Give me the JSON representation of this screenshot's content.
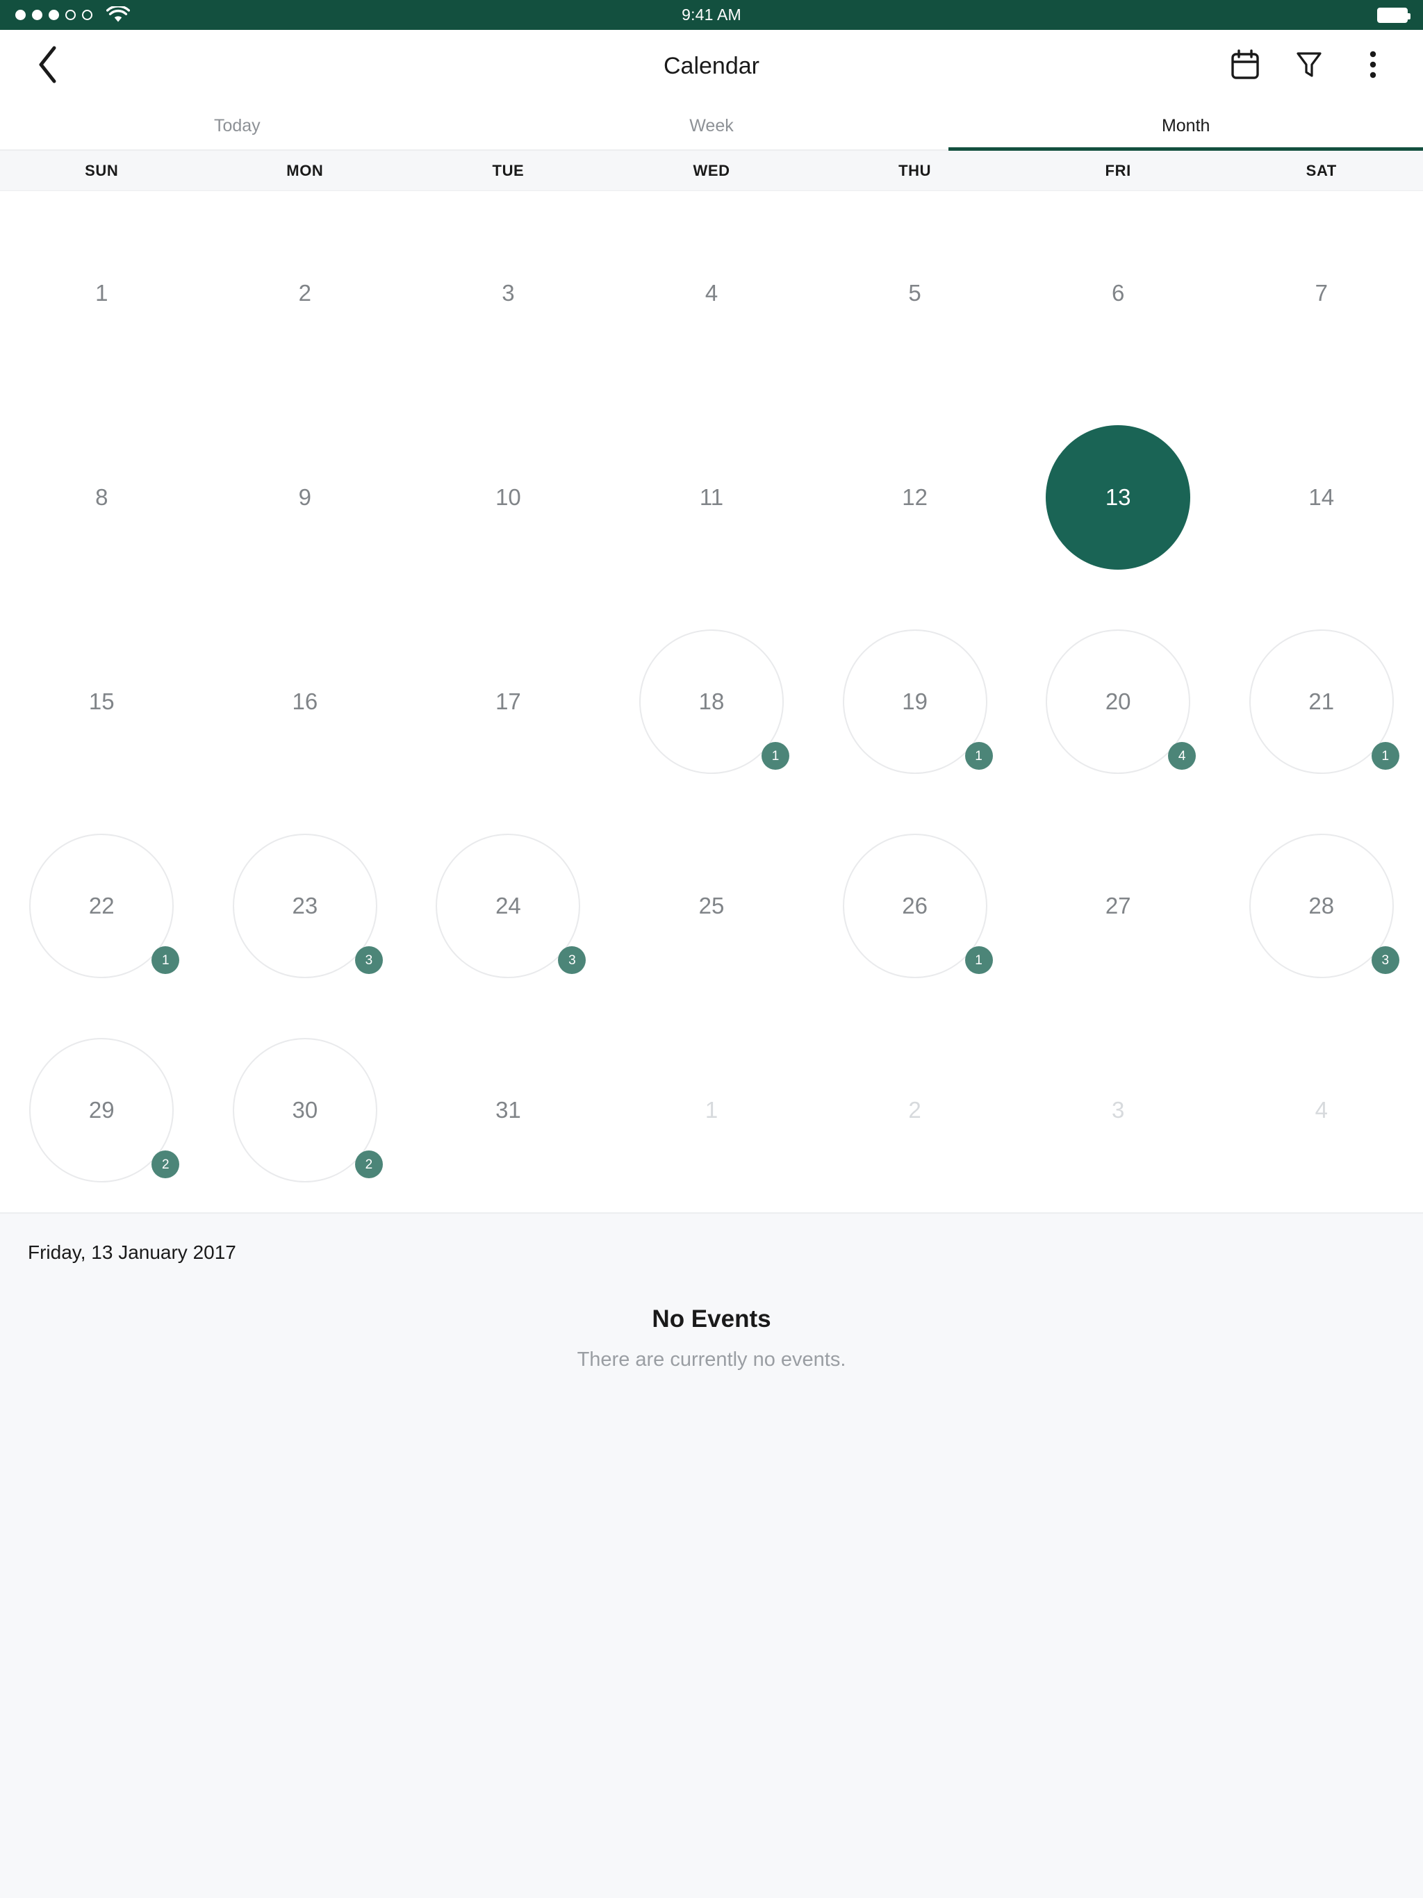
{
  "status_bar": {
    "time": "9:41 AM",
    "signal_dots_filled": 3,
    "signal_dots_total": 5,
    "wifi_icon": "wifi-icon",
    "battery_icon": "battery-full-icon",
    "background_color": "#13503F"
  },
  "nav": {
    "back_icon": "chevron-left-icon",
    "title": "Calendar",
    "actions": [
      {
        "icon": "calendar-icon",
        "name": "calendar-view-button"
      },
      {
        "icon": "filter-funnel-icon",
        "name": "filter-button"
      },
      {
        "icon": "overflow-menu-icon",
        "name": "overflow-menu-button"
      }
    ]
  },
  "tabs": {
    "items": [
      {
        "label": "Today",
        "active": false
      },
      {
        "label": "Week",
        "active": false
      },
      {
        "label": "Month",
        "active": true
      }
    ],
    "active_index": 2,
    "accent_color": "#13503F"
  },
  "weekdays": [
    "SUN",
    "MON",
    "TUE",
    "WED",
    "THU",
    "FRI",
    "SAT"
  ],
  "calendar": {
    "month_label": "January 2017",
    "selected_day": 13,
    "selected_color": "#1A6455",
    "badge_color": "#4C8578",
    "circle_outline_color": "#e9eaec",
    "weeks": [
      [
        {
          "day": "1",
          "in_month": true,
          "circle": false,
          "badge": null,
          "selected": false
        },
        {
          "day": "2",
          "in_month": true,
          "circle": false,
          "badge": null,
          "selected": false
        },
        {
          "day": "3",
          "in_month": true,
          "circle": false,
          "badge": null,
          "selected": false
        },
        {
          "day": "4",
          "in_month": true,
          "circle": false,
          "badge": null,
          "selected": false
        },
        {
          "day": "5",
          "in_month": true,
          "circle": false,
          "badge": null,
          "selected": false
        },
        {
          "day": "6",
          "in_month": true,
          "circle": false,
          "badge": null,
          "selected": false
        },
        {
          "day": "7",
          "in_month": true,
          "circle": false,
          "badge": null,
          "selected": false
        }
      ],
      [
        {
          "day": "8",
          "in_month": true,
          "circle": false,
          "badge": null,
          "selected": false
        },
        {
          "day": "9",
          "in_month": true,
          "circle": false,
          "badge": null,
          "selected": false
        },
        {
          "day": "10",
          "in_month": true,
          "circle": false,
          "badge": null,
          "selected": false
        },
        {
          "day": "11",
          "in_month": true,
          "circle": false,
          "badge": null,
          "selected": false
        },
        {
          "day": "12",
          "in_month": true,
          "circle": false,
          "badge": null,
          "selected": false
        },
        {
          "day": "13",
          "in_month": true,
          "circle": true,
          "badge": null,
          "selected": true
        },
        {
          "day": "14",
          "in_month": true,
          "circle": false,
          "badge": null,
          "selected": false
        }
      ],
      [
        {
          "day": "15",
          "in_month": true,
          "circle": false,
          "badge": null,
          "selected": false
        },
        {
          "day": "16",
          "in_month": true,
          "circle": false,
          "badge": null,
          "selected": false
        },
        {
          "day": "17",
          "in_month": true,
          "circle": false,
          "badge": null,
          "selected": false
        },
        {
          "day": "18",
          "in_month": true,
          "circle": true,
          "badge": "1",
          "selected": false
        },
        {
          "day": "19",
          "in_month": true,
          "circle": true,
          "badge": "1",
          "selected": false
        },
        {
          "day": "20",
          "in_month": true,
          "circle": true,
          "badge": "4",
          "selected": false
        },
        {
          "day": "21",
          "in_month": true,
          "circle": true,
          "badge": "1",
          "selected": false
        }
      ],
      [
        {
          "day": "22",
          "in_month": true,
          "circle": true,
          "badge": "1",
          "selected": false
        },
        {
          "day": "23",
          "in_month": true,
          "circle": true,
          "badge": "3",
          "selected": false
        },
        {
          "day": "24",
          "in_month": true,
          "circle": true,
          "badge": "3",
          "selected": false
        },
        {
          "day": "25",
          "in_month": true,
          "circle": false,
          "badge": null,
          "selected": false
        },
        {
          "day": "26",
          "in_month": true,
          "circle": true,
          "badge": "1",
          "selected": false
        },
        {
          "day": "27",
          "in_month": true,
          "circle": false,
          "badge": null,
          "selected": false
        },
        {
          "day": "28",
          "in_month": true,
          "circle": true,
          "badge": "3",
          "selected": false
        }
      ],
      [
        {
          "day": "29",
          "in_month": true,
          "circle": true,
          "badge": "2",
          "selected": false
        },
        {
          "day": "30",
          "in_month": true,
          "circle": true,
          "badge": "2",
          "selected": false
        },
        {
          "day": "31",
          "in_month": true,
          "circle": false,
          "badge": null,
          "selected": false
        },
        {
          "day": "1",
          "in_month": false,
          "circle": false,
          "badge": null,
          "selected": false
        },
        {
          "day": "2",
          "in_month": false,
          "circle": false,
          "badge": null,
          "selected": false
        },
        {
          "day": "3",
          "in_month": false,
          "circle": false,
          "badge": null,
          "selected": false
        },
        {
          "day": "4",
          "in_month": false,
          "circle": false,
          "badge": null,
          "selected": false
        }
      ]
    ]
  },
  "events_panel": {
    "selected_date_label": "Friday, 13 January 2017",
    "empty_title": "No Events",
    "empty_subtitle": "There are currently no events."
  }
}
